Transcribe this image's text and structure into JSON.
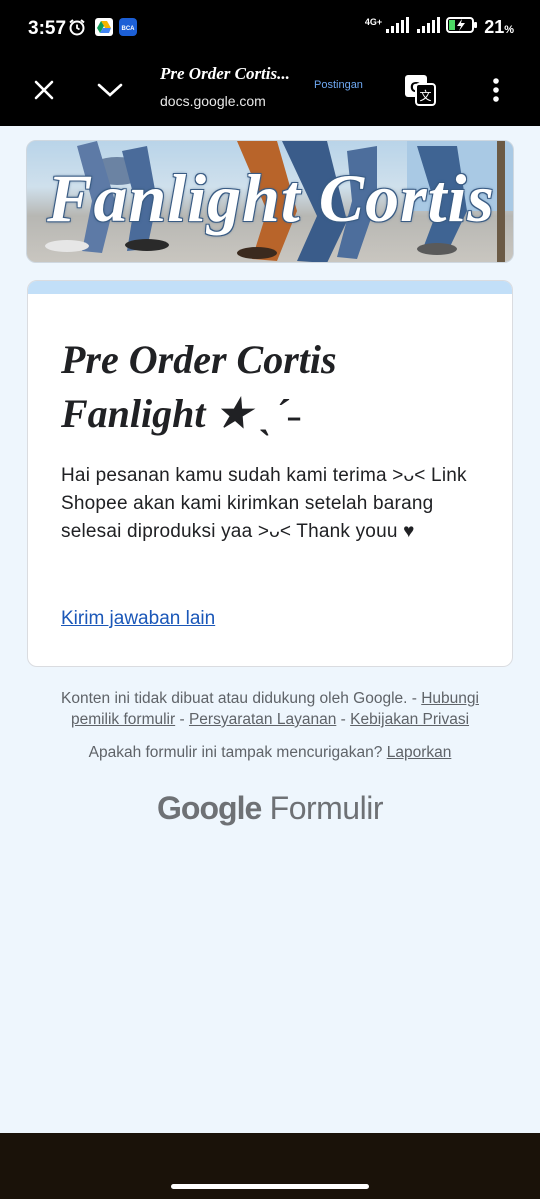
{
  "status_bar": {
    "time": "3:57",
    "network": "4G+",
    "battery": "21",
    "battery_unit": "%",
    "icons": [
      "alarm-icon",
      "drive-icon",
      "bca-app-icon",
      "signal-icon",
      "signal-icon",
      "battery-charging-icon"
    ]
  },
  "app_bar": {
    "title": "Pre Order Cortis...",
    "url": "docs.google.com",
    "tag": "Postingan",
    "icons": [
      "close-icon",
      "chevron-down-icon",
      "translate-icon",
      "more-vert-icon"
    ]
  },
  "banner": {
    "text": "Fanlight Cortis"
  },
  "form": {
    "title": "Pre Order Cortis Fanlight ★ ˎˊ˗",
    "message": "Hai pesanan kamu sudah kami terima >ᴗ< Link Shopee akan kami kirimkan setelah barang selesai diproduksi yaa >ᴗ< Thank youu ♥",
    "link": "Kirim jawaban lain",
    "accent_color": "#c2dff8"
  },
  "footer": {
    "disclaimer": "Konten ini tidak dibuat atau didukung oleh Google. -",
    "link_contact": "Hubungi pemilik formulir",
    "sep1": "-",
    "link_terms": "Persyaratan Layanan",
    "sep2": "-",
    "link_privacy": "Kebijakan Privasi",
    "suspicious": "Apakah formulir ini tampak mencurigakan?",
    "link_report": "Laporkan",
    "brand_google": "Google",
    "brand_product": "Formulir"
  }
}
